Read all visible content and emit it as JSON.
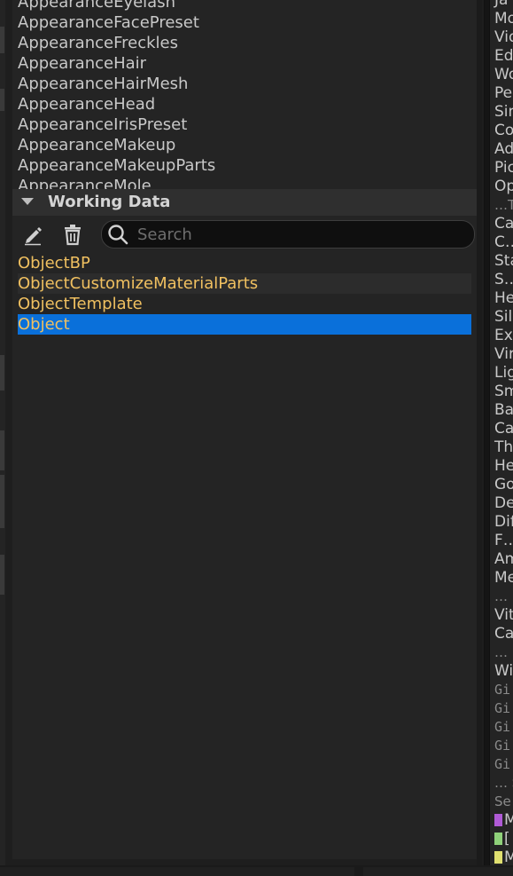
{
  "top_list": {
    "items": [
      "AppearanceEyelash",
      "AppearanceFacePreset",
      "AppearanceFreckles",
      "AppearanceHair",
      "AppearanceHairMesh",
      "AppearanceHead",
      "AppearanceIrisPreset",
      "AppearanceMakeup",
      "AppearanceMakeupParts",
      "AppearanceMole"
    ]
  },
  "working_data": {
    "title": "Working Data",
    "search_placeholder": "Search",
    "search_value": "",
    "items": [
      "ObjectBP",
      "ObjectCustomizeMaterialParts",
      "ObjectTemplate",
      "Object"
    ],
    "selected_index": 3
  },
  "right_panel": {
    "items": [
      "Ja",
      "Mo",
      "Vid",
      "Ed",
      "Wo",
      "Pe",
      "Sin",
      "Co",
      "Ad",
      "Pic",
      "Op",
      "…To",
      "Ca",
      "C…",
      "Sta",
      "S…",
      "He",
      "Sil",
      "Exp",
      "Vir",
      "Lig",
      "Sm",
      "Ba",
      "Ca",
      "Th",
      "He",
      "Go",
      "De",
      "Dif",
      "F…",
      "Am",
      "Me",
      "…",
      "Vit",
      "Ca",
      "… (",
      "Wi"
    ],
    "mono_items": [
      "Gi",
      "Gi",
      "Gi",
      "Gi",
      "Gi"
    ],
    "tail_items": [
      "… S",
      "Se"
    ],
    "swatch_items": [
      {
        "label": "M",
        "color": "#b05ad6"
      },
      {
        "label": "[",
        "color": "#8fd17a"
      },
      {
        "label": "M",
        "color": "#e0e070"
      }
    ]
  },
  "colors": {
    "accent_selection": "#0a70da",
    "asset_text": "#f0c060",
    "panel_bg": "#242424"
  },
  "icons": {
    "edit": "pencil-icon",
    "delete": "trash-icon",
    "search": "search-icon",
    "collapse": "caret-down-icon"
  }
}
